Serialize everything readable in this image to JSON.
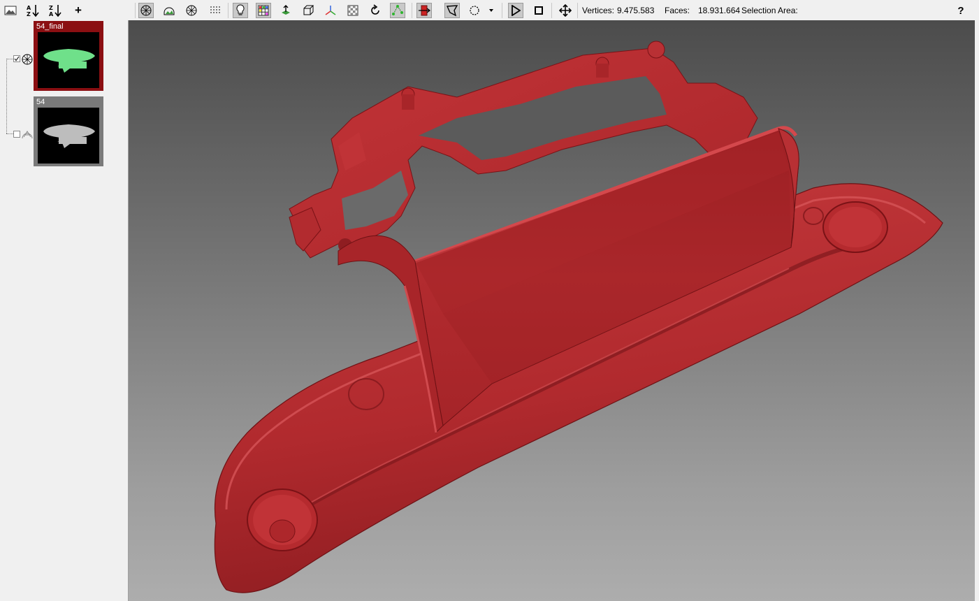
{
  "toolbar": {
    "vertices_label": "Vertices:",
    "vertices_value": "9.475.583",
    "faces_label": "Faces:",
    "faces_value": "18.931.664",
    "selection_label": "Selection Area:",
    "help_label": "?",
    "add_label": "+"
  },
  "layers": [
    {
      "name": "54_final",
      "visible": true,
      "selected": true,
      "color": "#8b0f12",
      "mesh_color": "#6fe08a"
    },
    {
      "name": "54",
      "visible": false,
      "selected": false,
      "color": "#7a7a7a",
      "mesh_color": "#bdbdbd"
    }
  ],
  "viewport": {
    "model_color": "#b52a2e",
    "background_top": "#4c4c4c",
    "background_bottom": "#adadad"
  }
}
